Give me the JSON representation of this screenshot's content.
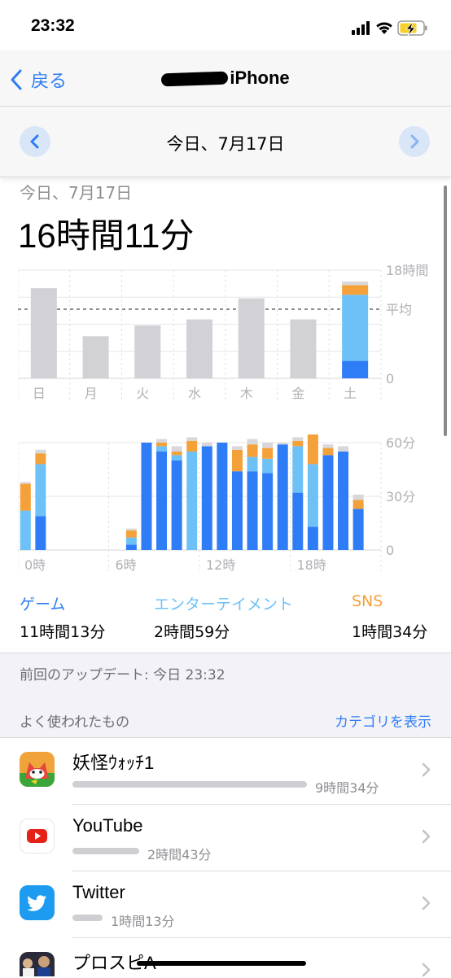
{
  "status": {
    "time": "23:32"
  },
  "nav": {
    "back_label": "戻る",
    "title_suffix": "iPhone"
  },
  "date_bar": {
    "label": "今日、7月17日"
  },
  "summary": {
    "date": "今日、7月17日",
    "total": "16時間11分"
  },
  "weekly": {
    "y_labels": [
      "18時間",
      "平均",
      "0"
    ],
    "days": [
      "日",
      "月",
      "火",
      "水",
      "木",
      "金",
      "土"
    ]
  },
  "hourly": {
    "y_labels": [
      "60分",
      "30分",
      "0"
    ],
    "x_labels": [
      "0時",
      "6時",
      "12時",
      "18時"
    ]
  },
  "legend": [
    {
      "label": "ゲーム",
      "value": "11時間13分",
      "color": "#2f7df6"
    },
    {
      "label": "エンターテイメント",
      "value": "2時間59分",
      "color": "#6ec1f7"
    },
    {
      "label": "SNS",
      "value": "1時間34分",
      "color": "#f5a13a"
    }
  ],
  "updated": "前回のアップデート: 今日 23:32",
  "most_used": {
    "label": "よく使われたもの",
    "link": "カテゴリを表示"
  },
  "apps": [
    {
      "name": "妖怪ｳｫｯﾁ1",
      "time": "9時間34分",
      "icon": "yokai-watch-app-icon"
    },
    {
      "name": "YouTube",
      "time": "2時間43分",
      "icon": "youtube-app-icon"
    },
    {
      "name": "Twitter",
      "time": "1時間13分",
      "icon": "twitter-app-icon"
    },
    {
      "name": "プロスピA",
      "time": "",
      "icon": "prospi-app-icon"
    }
  ],
  "chart_data": [
    {
      "type": "bar",
      "categories": [
        "日",
        "月",
        "火",
        "水",
        "木",
        "金",
        "土"
      ],
      "y_ticks": [
        "18時間",
        "平均",
        "0"
      ],
      "series": [
        {
          "name": "ゲーム",
          "values": [
            0,
            0,
            0,
            0,
            0,
            0,
            2.9
          ]
        },
        {
          "name": "エンターテイメント",
          "values": [
            0,
            0,
            0,
            0,
            0,
            0,
            11.0
          ]
        },
        {
          "name": "SNS",
          "values": [
            0,
            0,
            0,
            0,
            0,
            0,
            1.6
          ]
        }
      ],
      "previous_days_hours": [
        15.0,
        7.0,
        8.8,
        9.8,
        13.3,
        9.8,
        0
      ],
      "other_hours_saturday": 0.6,
      "average_hours": 11.5,
      "ylim": [
        0,
        18
      ],
      "grid": true
    },
    {
      "type": "bar",
      "x_ticks": [
        "0時",
        "6時",
        "12時",
        "18時"
      ],
      "y_ticks": [
        "60分",
        "30分",
        "0"
      ],
      "ylim": [
        0,
        60
      ],
      "hours": [
        0,
        1,
        2,
        3,
        4,
        5,
        6,
        7,
        8,
        9,
        10,
        11,
        12,
        13,
        14,
        15,
        16,
        17,
        18,
        19,
        20,
        21,
        22,
        23
      ],
      "series": [
        {
          "name": "ゲーム",
          "values": [
            0,
            19,
            0,
            0,
            0,
            0,
            0,
            3,
            60,
            55,
            50,
            0,
            58,
            60,
            44,
            44,
            43,
            59,
            32,
            13,
            53,
            55,
            23,
            0
          ]
        },
        {
          "name": "エンターテイメント",
          "values": [
            22,
            29,
            0,
            0,
            0,
            0,
            0,
            4,
            0,
            3,
            3,
            55,
            0,
            0,
            0,
            8,
            8,
            0,
            26,
            35,
            0,
            0,
            0,
            0
          ]
        },
        {
          "name": "SNS",
          "values": [
            15,
            6,
            0,
            0,
            0,
            0,
            0,
            4,
            0,
            2,
            2,
            6,
            0,
            0,
            12,
            7,
            6,
            0,
            3,
            22,
            4,
            0,
            5,
            0
          ]
        }
      ],
      "other_minutes": [
        1,
        2,
        0,
        0,
        0,
        0,
        0,
        1,
        0,
        2,
        3,
        2,
        2,
        0,
        2,
        3,
        3,
        1,
        2,
        2,
        2,
        3,
        3,
        0
      ]
    }
  ]
}
